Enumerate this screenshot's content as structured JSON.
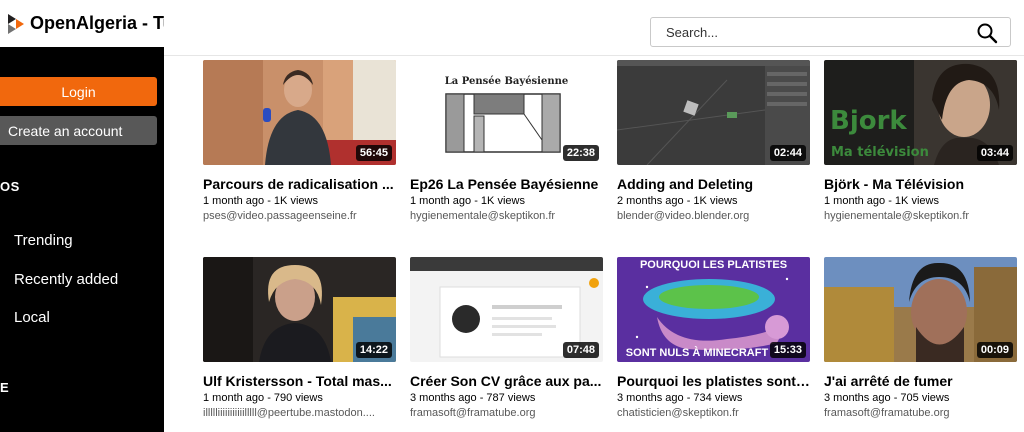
{
  "app": {
    "title": "OpenAlgeria - Tu"
  },
  "search": {
    "placeholder": "Search..."
  },
  "sidebar": {
    "login_label": "Login",
    "create_account_label": "Create an account",
    "videos_heading": "OS",
    "items": [
      {
        "label": "Trending"
      },
      {
        "label": "Recently added"
      },
      {
        "label": "Local"
      }
    ],
    "more_heading": "E"
  },
  "colors": {
    "accent": "#f1680d",
    "secondary_button": "#585858",
    "sidebar_bg": "#000000"
  },
  "thumb_text": {
    "pensee_heading": "La Pensée Bayésienne",
    "bjork_title": "Bjork",
    "bjork_sub": "Ma télévision",
    "platistes_top": "POURQUOI LES PLATISTES",
    "platistes_bottom": "SONT NULS À MINECRAFT"
  },
  "videos": [
    {
      "title": "Parcours de radicalisation ...",
      "meta": "1 month ago - 1K views",
      "account": "pses@video.passageenseine.fr",
      "duration": "56:45"
    },
    {
      "title": "Ep26 La Pensée Bayésienne",
      "meta": "1 month ago - 1K views",
      "account": "hygienementale@skeptikon.fr",
      "duration": "22:38"
    },
    {
      "title": "Adding and Deleting",
      "meta": "2 months ago - 1K views",
      "account": "blender@video.blender.org",
      "duration": "02:44"
    },
    {
      "title": "Björk - Ma Télévision",
      "meta": "1 month ago - 1K views",
      "account": "hygienementale@skeptikon.fr",
      "duration": "03:44"
    },
    {
      "title": "Ulf Kristersson - Total mas...",
      "meta": "1 month ago - 790 views",
      "account": "illllliiiiiiiiiiilllll@peertube.mastodon....",
      "duration": "14:22"
    },
    {
      "title": "Créer Son CV grâce aux pa...",
      "meta": "3 months ago - 787 views",
      "account": "framasoft@framatube.org",
      "duration": "07:48"
    },
    {
      "title": "Pourquoi les platistes sont ...",
      "meta": "3 months ago - 734 views",
      "account": "chatisticien@skeptikon.fr",
      "duration": "15:33"
    },
    {
      "title": "J'ai arrêté de fumer",
      "meta": "3 months ago - 705 views",
      "account": "framasoft@framatube.org",
      "duration": "00:09"
    }
  ]
}
